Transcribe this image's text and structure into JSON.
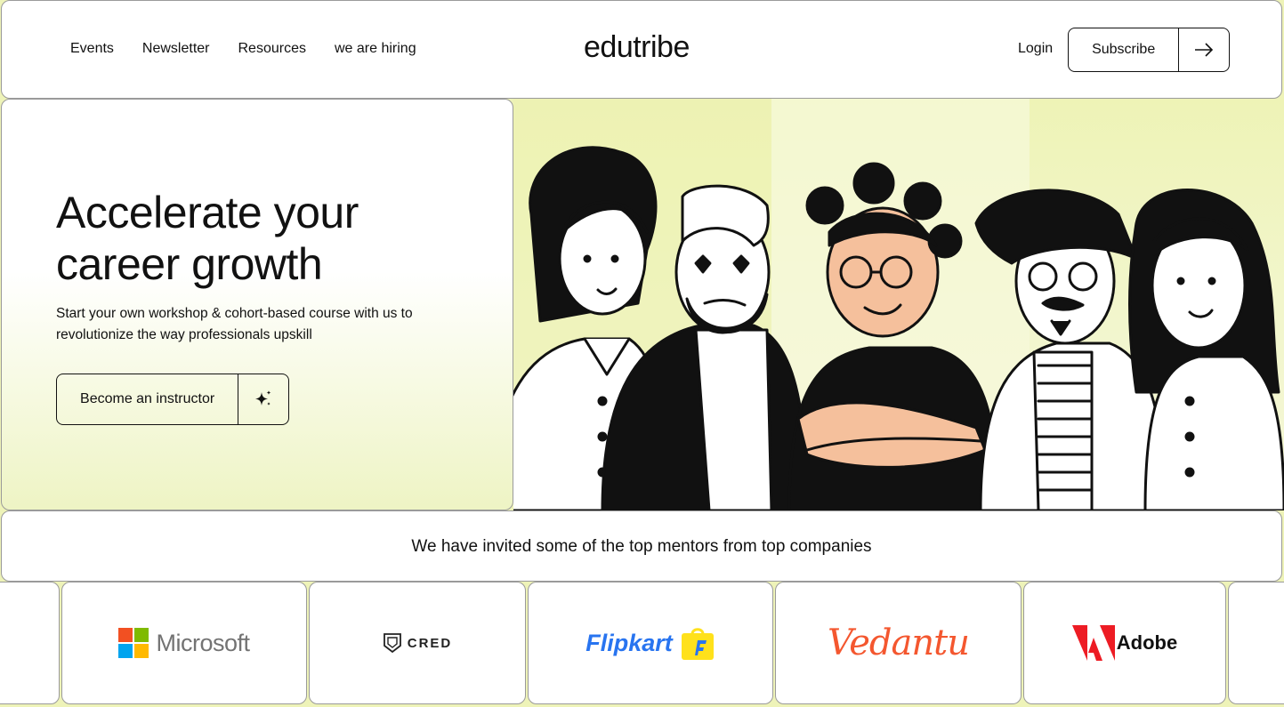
{
  "header": {
    "nav": [
      "Events",
      "Newsletter",
      "Resources",
      "we are hiring"
    ],
    "logo": "edutribe",
    "login": "Login",
    "subscribe": "Subscribe"
  },
  "hero": {
    "title_line1": "Accelerate your",
    "title_line2": "career growth",
    "subtitle_line1": "Start your own workshop & cohort-based course with us to",
    "subtitle_line2": "revolutionize the way professionals upskill",
    "cta": "Become an instructor",
    "cta_icon": "sparkle-icon"
  },
  "mentors": {
    "heading": "We have invited some of the top mentors from top companies"
  },
  "companies": [
    "Microsoft",
    "CRED",
    "Flipkart",
    "Vedantu",
    "Adobe"
  ],
  "colors": {
    "background": "#eef3b8",
    "skin": "#f5c09c",
    "microsoft_red": "#f25022",
    "microsoft_green": "#7fba00",
    "microsoft_blue": "#00a4ef",
    "microsoft_yellow": "#ffb900",
    "flipkart_blue": "#2874f0",
    "flipkart_yellow": "#ffe11b",
    "vedantu_orange": "#f4572f",
    "adobe_red": "#ed1c24"
  }
}
